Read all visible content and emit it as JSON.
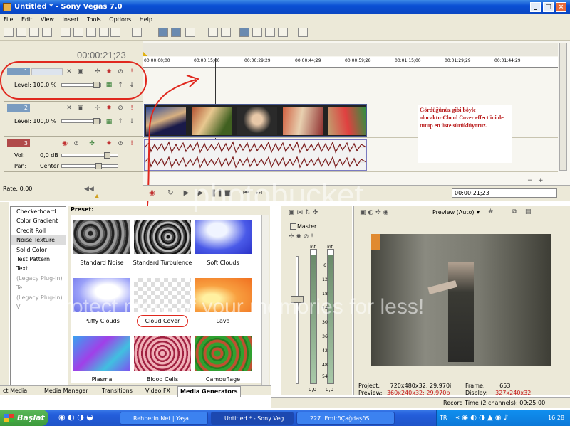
{
  "window": {
    "title": "Untitled * - Sony Vegas 7.0",
    "min": "_",
    "max": "□",
    "close": "×"
  },
  "menu": [
    "File",
    "Edit",
    "View",
    "Insert",
    "Tools",
    "Options",
    "Help"
  ],
  "timeline": {
    "timecode": "00:00:21;23",
    "ruler_ticks": [
      "00:00:00;00",
      "00:00:15;00",
      "00:00:29;29",
      "00:00:44;29",
      "00:00:59;28",
      "00:01:15;00",
      "00:01:29;29",
      "00:01:44;29"
    ],
    "tracks": [
      {
        "number": "1",
        "level_label": "Level: 100,0 %"
      },
      {
        "number": "2",
        "level_label": "Level: 100,0 %"
      },
      {
        "number": "3",
        "vol_label": "Vol:",
        "vol_value": "0,0 dB",
        "pan_label": "Pan:",
        "pan_value": "Center"
      }
    ],
    "rate": "Rate: 0,00",
    "transport_timecode": "00:00:21;23"
  },
  "overlay_note": "Gördüğünüz gibi böyle olucaktır.Cloud Cover effect'ini de tutup en üste sürüklüyoruz.",
  "generators": {
    "list": [
      "Checkerboard",
      "Color Gradient",
      "Credit Roll",
      "Noise Texture",
      "Solid Color",
      "Test Pattern",
      "Text",
      "(Legacy Plug-In) Te",
      "(Legacy Plug-In) Vi"
    ],
    "selected": "Noise Texture",
    "preset_label": "Preset:",
    "presets": [
      "Standard Noise",
      "Standard Turbulence",
      "Soft Clouds",
      "Puffy Clouds",
      "Cloud Cover",
      "Lava",
      "Plasma",
      "Blood Cells",
      "Camouflage"
    ]
  },
  "tabs": [
    "ct Media",
    "Media Manager",
    "Transitions",
    "Video FX",
    "Media Generators"
  ],
  "mixer": {
    "title": "Master",
    "peak_left": "-Inf.",
    "peak_right": "-Inf.",
    "scale": [
      "6",
      "12",
      "18",
      "24",
      "30",
      "36",
      "42",
      "48",
      "54"
    ],
    "out_left": "0,0",
    "out_right": "0,0"
  },
  "preview": {
    "mode": "Preview (Auto)",
    "project_label": "Project:",
    "project_value": "720x480x32; 29,970i",
    "preview_label": "Preview:",
    "preview_value": "360x240x32; 29,970p",
    "frame_label": "Frame:",
    "frame_value": "653",
    "display_label": "Display:",
    "display_value": "327x240x32"
  },
  "status": "Record Time (2 channels): 09:25:00",
  "taskbar": {
    "start": "Başlat",
    "tasks": [
      "Rehberin.Net | Yaşa...",
      "Untitled * - Sony Veg...",
      "227. EmirðÇağdaşðS..."
    ],
    "lang": "TR",
    "clock": "16:28"
  },
  "watermark": {
    "logo": "photobucket",
    "tagline": "Protect more of your memories for less!"
  },
  "colors": {
    "accent": "#0a4fd4",
    "annotation": "#e0281e",
    "note_text": "#b81818"
  }
}
